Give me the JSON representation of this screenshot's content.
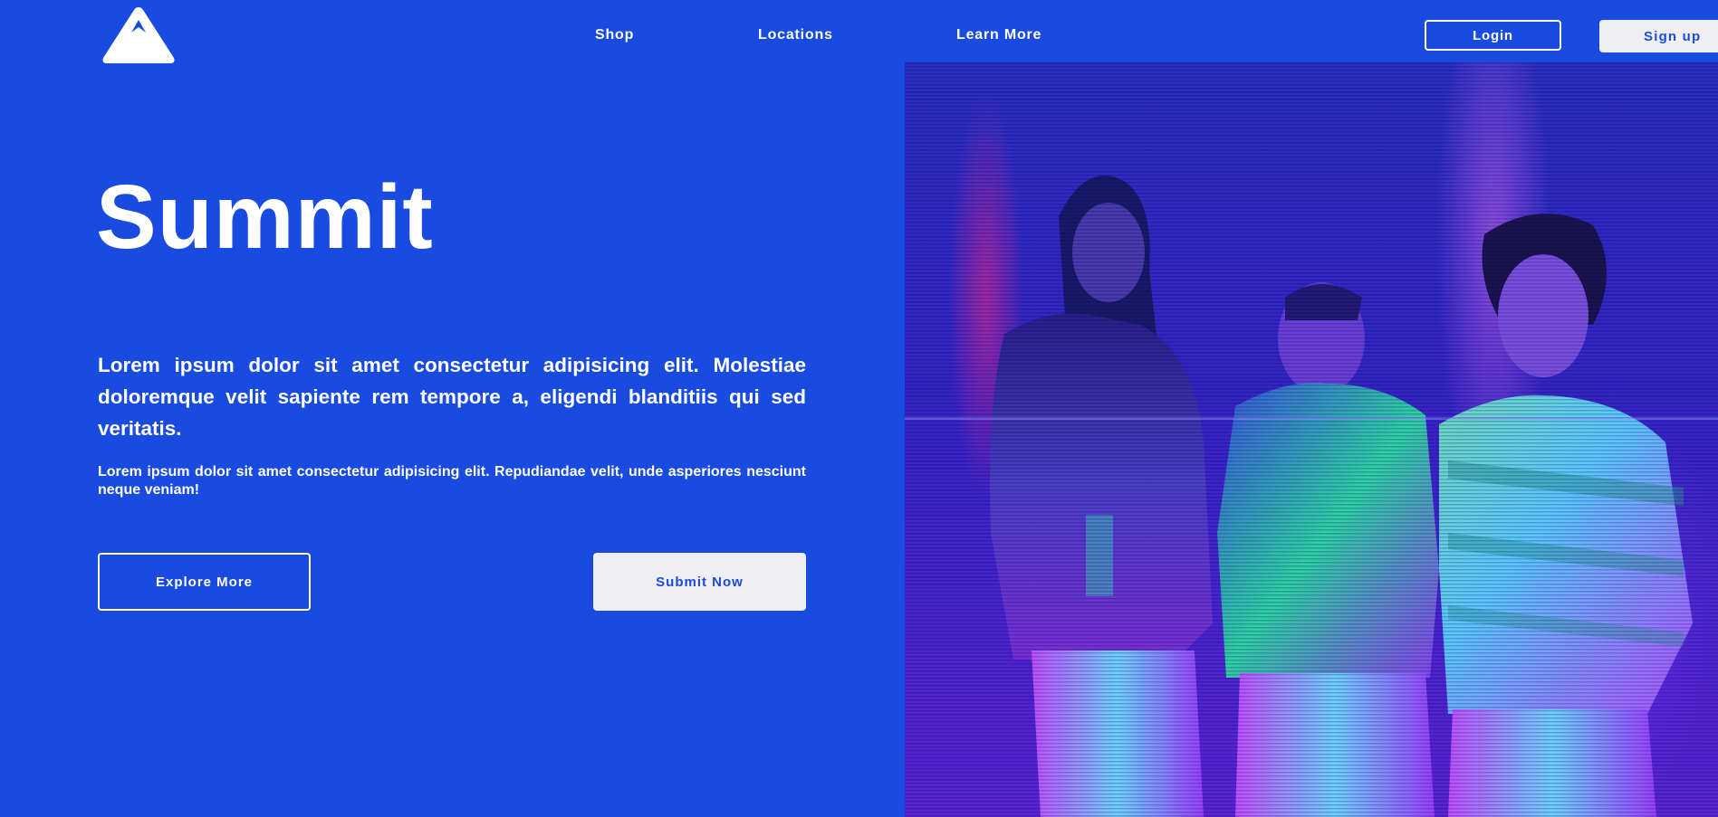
{
  "brand": {
    "logo_icon": "mountain-icon"
  },
  "nav": {
    "items": [
      {
        "label": "Shop"
      },
      {
        "label": "Locations"
      },
      {
        "label": "Learn More"
      }
    ]
  },
  "auth": {
    "login_label": "Login",
    "signup_label": "Sign up"
  },
  "hero": {
    "title": "Summit",
    "lead": "Lorem ipsum dolor sit amet consectetur adipisicing elit. Molestiae doloremque velit sapiente rem tempore a, eligendi blanditiis qui sed veritatis.",
    "sub": "Lorem ipsum dolor sit amet consectetur adipisicing elit. Repudiandae velit, unde asperiores nesciunt neque veniam!",
    "explore_label": "Explore More",
    "submit_label": "Submit Now"
  },
  "colors": {
    "background": "#1a4be0",
    "text": "#ffffff",
    "light_button": "#efeef2"
  }
}
